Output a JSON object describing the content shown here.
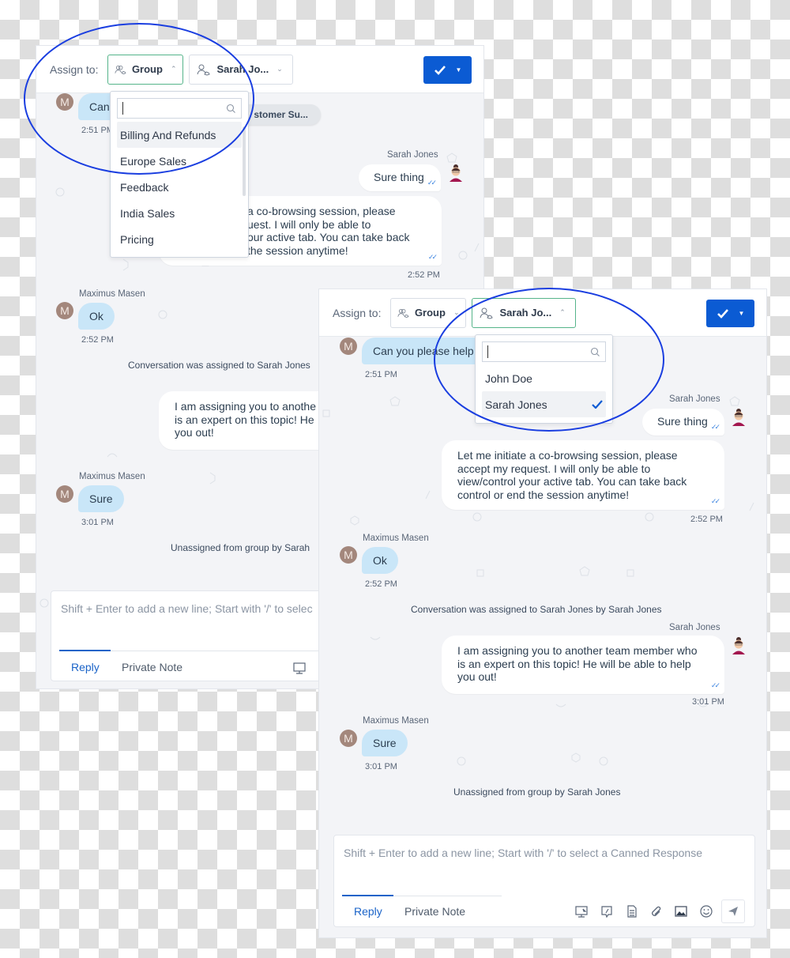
{
  "left_panel": {
    "header": {
      "assign_label": "Assign to:",
      "group_dropdown": {
        "label": "Group",
        "state": "open",
        "icon": "group-icon"
      },
      "agent_dropdown": {
        "label": "Sarah Jo...",
        "state": "closed",
        "icon": "agent-icon"
      },
      "resolve_button": {
        "icon": "check-icon",
        "menu_icon": "caret-down-icon"
      }
    },
    "group_menu": {
      "search_placeholder": "",
      "options": [
        "Billing And Refunds",
        "Europe Sales",
        "Feedback",
        "India Sales",
        "Pricing"
      ],
      "highlighted": "Billing And Refunds"
    },
    "messages": {
      "first_customer_text": "Can",
      "first_time": "2:51 PM",
      "pill_text": "stomer Su...",
      "agent_name_1": "Sarah Jones",
      "agent_msg_1": "Sure thing",
      "agent_msg_2_lines": [
        "a co-browsing session, please",
        "uest. I will only be able to",
        "our active tab. You can take back",
        "the session anytime!"
      ],
      "agent_time_2": "2:52 PM",
      "customer_name": "Maximus Masen",
      "customer_msg_2": "Ok",
      "customer_time_2": "2:52 PM",
      "system_1": "Conversation was assigned to Sarah Jones",
      "agent_msg_3_lines": [
        "I am assigning you to anothe",
        "is an expert on this topic! He",
        "you out!"
      ],
      "customer_msg_3": "Sure",
      "customer_time_3": "3:01 PM",
      "system_2": "Unassigned from group by Sarah"
    },
    "composer": {
      "placeholder": "Shift + Enter to add a new line; Start with '/' to selec",
      "tab_reply": "Reply",
      "tab_note": "Private Note"
    }
  },
  "right_panel": {
    "header": {
      "assign_label": "Assign to:",
      "group_dropdown": {
        "label": "Group",
        "state": "closed",
        "icon": "group-icon"
      },
      "agent_dropdown": {
        "label": "Sarah Jo...",
        "state": "open",
        "icon": "agent-icon"
      },
      "resolve_button": {
        "icon": "check-icon",
        "menu_icon": "caret-down-icon"
      }
    },
    "agent_menu": {
      "search_placeholder": "",
      "options": [
        {
          "label": "John Doe",
          "selected": false
        },
        {
          "label": "Sarah Jones",
          "selected": true
        }
      ]
    },
    "messages": {
      "first_customer_text": "Can you please help",
      "first_time": "2:51 PM",
      "agent_name": "Sarah Jones",
      "agent_msg_1": "Sure thing",
      "agent_msg_2_lines": [
        "Let me initiate a co-browsing session, please",
        "accept my request. I will only be able to",
        "view/control your active tab. You can take back",
        "control or end the session anytime!"
      ],
      "agent_time_2": "2:52 PM",
      "customer_name": "Maximus Masen",
      "customer_avatar_initial": "M",
      "customer_msg_2": "Ok",
      "customer_time_2": "2:52 PM",
      "system_1": "Conversation was assigned to Sarah Jones by Sarah Jones",
      "agent_msg_3_lines": [
        "I am assigning you to another team member who",
        "is an expert on this topic! He will be able to help",
        "you out!"
      ],
      "agent_time_3": "3:01 PM",
      "customer_msg_3": "Sure",
      "customer_time_3": "3:01 PM",
      "system_2": "Unassigned from group by Sarah Jones"
    },
    "composer": {
      "placeholder": "Shift + Enter to add a new line; Start with '/' to select a Canned Response",
      "tab_reply": "Reply",
      "tab_note": "Private Note",
      "tools": [
        "cobrowse-icon",
        "canned-response-icon",
        "article-icon",
        "attachment-icon",
        "image-icon",
        "emoji-icon",
        "send-icon"
      ]
    }
  },
  "colors": {
    "primary": "#0b5bd3",
    "open_dropdown_border": "#55b48a",
    "customer_bubble": "#c9e6f8",
    "avatar": "#a3877c",
    "annotation_circle": "#1a3ee0",
    "chat_background": "#f3f4f7"
  }
}
